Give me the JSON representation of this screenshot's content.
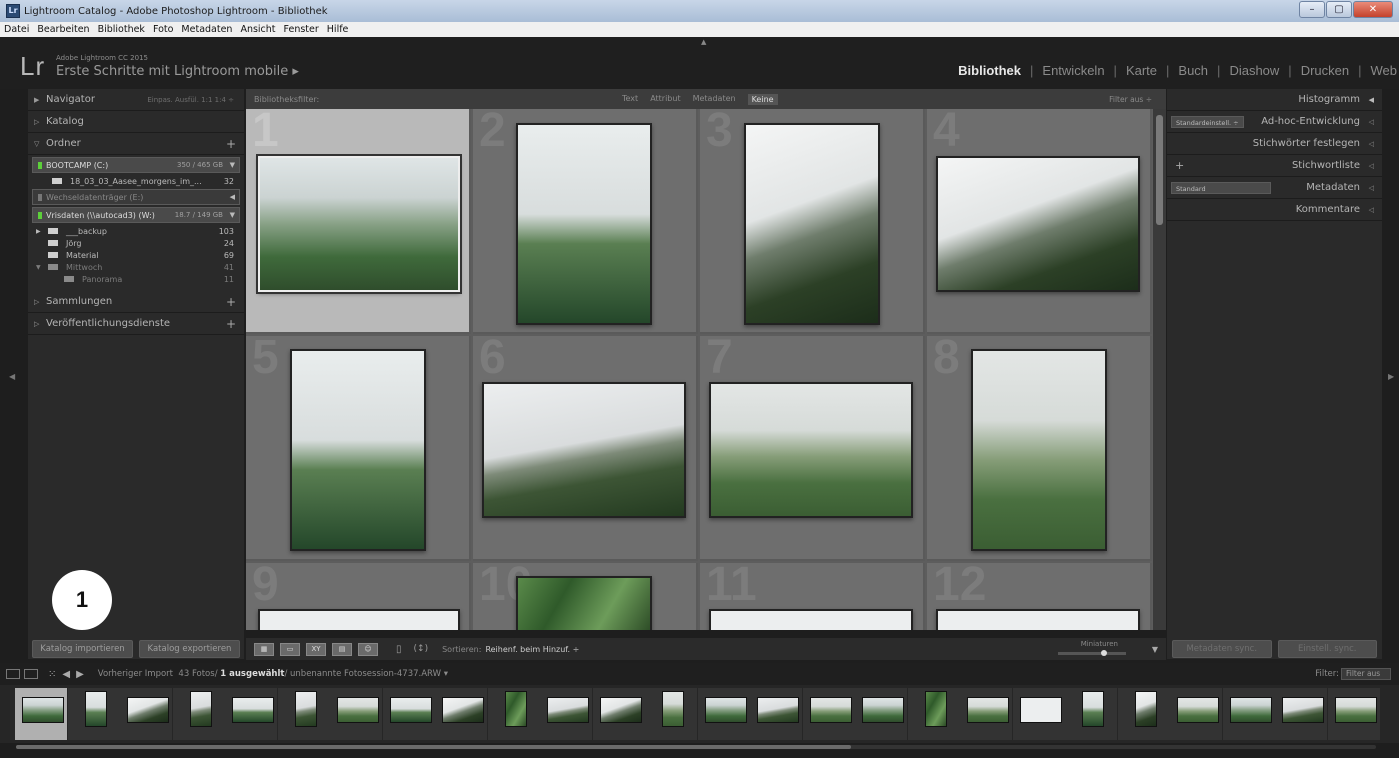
{
  "window": {
    "title": "Lightroom Catalog - Adobe Photoshop Lightroom - Bibliothek",
    "app_icon": "Lr",
    "min": "–",
    "max": "▢",
    "close": "✕"
  },
  "menu": [
    "Datei",
    "Bearbeiten",
    "Bibliothek",
    "Foto",
    "Metadaten",
    "Ansicht",
    "Fenster",
    "Hilfe"
  ],
  "header": {
    "logo": "Lr",
    "product": "Adobe Lightroom CC 2015",
    "catalog": "Erste Schritte mit Lightroom mobile ▸",
    "modules": [
      "Bibliothek",
      "Entwickeln",
      "Karte",
      "Buch",
      "Diashow",
      "Drucken",
      "Web"
    ],
    "active_module": "Bibliothek"
  },
  "left_panel": {
    "navigator": {
      "label": "Navigator",
      "options": "Einpas.  Ausfül.  1:1  1:4 ÷"
    },
    "catalog": "Katalog",
    "folders": {
      "label": "Ordner",
      "volumes": [
        {
          "name": "BOOTCAMP (C:)",
          "cap": "350 / 465 GB"
        },
        {
          "name": "Wechseldatenträger (E:)",
          "cap": ""
        },
        {
          "name": "Vrisdaten (\\\\autocad3) (W:)",
          "cap": "18.7 / 149 GB"
        }
      ],
      "items": [
        {
          "name": "18_03_03_Aasee_morgens_im_...",
          "count": "32"
        },
        {
          "name": "___backup",
          "count": "103"
        },
        {
          "name": "Jörg",
          "count": "24"
        },
        {
          "name": "Material",
          "count": "69"
        },
        {
          "name": "Mittwoch",
          "count": "41"
        },
        {
          "name": "Panorama",
          "count": "11"
        }
      ]
    },
    "collections": "Sammlungen",
    "publish": "Veröffentlichungsdienste",
    "import_btn": "Katalog importieren",
    "export_btn": "Katalog exportieren"
  },
  "callout": "1",
  "filter_bar": {
    "label": "Bibliotheksfilter:",
    "options": [
      "Text",
      "Attribut",
      "Metadaten",
      "Keine"
    ],
    "active": "Keine",
    "right": "Filter aus ÷"
  },
  "grid": {
    "cells": [
      {
        "num": "1"
      },
      {
        "num": "2"
      },
      {
        "num": "3"
      },
      {
        "num": "4"
      },
      {
        "num": "5"
      },
      {
        "num": "6"
      },
      {
        "num": "7"
      },
      {
        "num": "8"
      },
      {
        "num": "9"
      },
      {
        "num": "10"
      },
      {
        "num": "11"
      },
      {
        "num": "12"
      }
    ]
  },
  "toolbar": {
    "sort_label": "Sortieren:",
    "sort_value": "Reihenf. beim Hinzuf. ÷",
    "thumb_label": "Miniaturen",
    "thumb_size": 0.7
  },
  "right_panel": {
    "histogram": "Histogramm",
    "adhoc": "Ad-hoc-Entwicklung",
    "adhoc_preset": "Standardeinstell. ÷",
    "keywords_set": "Stichwörter festlegen",
    "keyword_list": "Stichwortliste",
    "metadata": "Metadaten",
    "metadata_preset": "Standard",
    "comments": "Kommentare",
    "sync_meta": "Metadaten sync.",
    "sync_settings": "Einstell. sync."
  },
  "filmstrip_bar": {
    "source": "Vorheriger Import",
    "count": "43 Fotos/",
    "selected": "1 ausgewählt",
    "file": "/ unbenannte Fotosession-4737.ARW ▾",
    "filter_label": "Filter:",
    "filter_value": "Filter aus"
  },
  "colors": {
    "accent": "#5ccf3a",
    "panel": "#2a2a2a",
    "grid": "#6e6e6e"
  }
}
